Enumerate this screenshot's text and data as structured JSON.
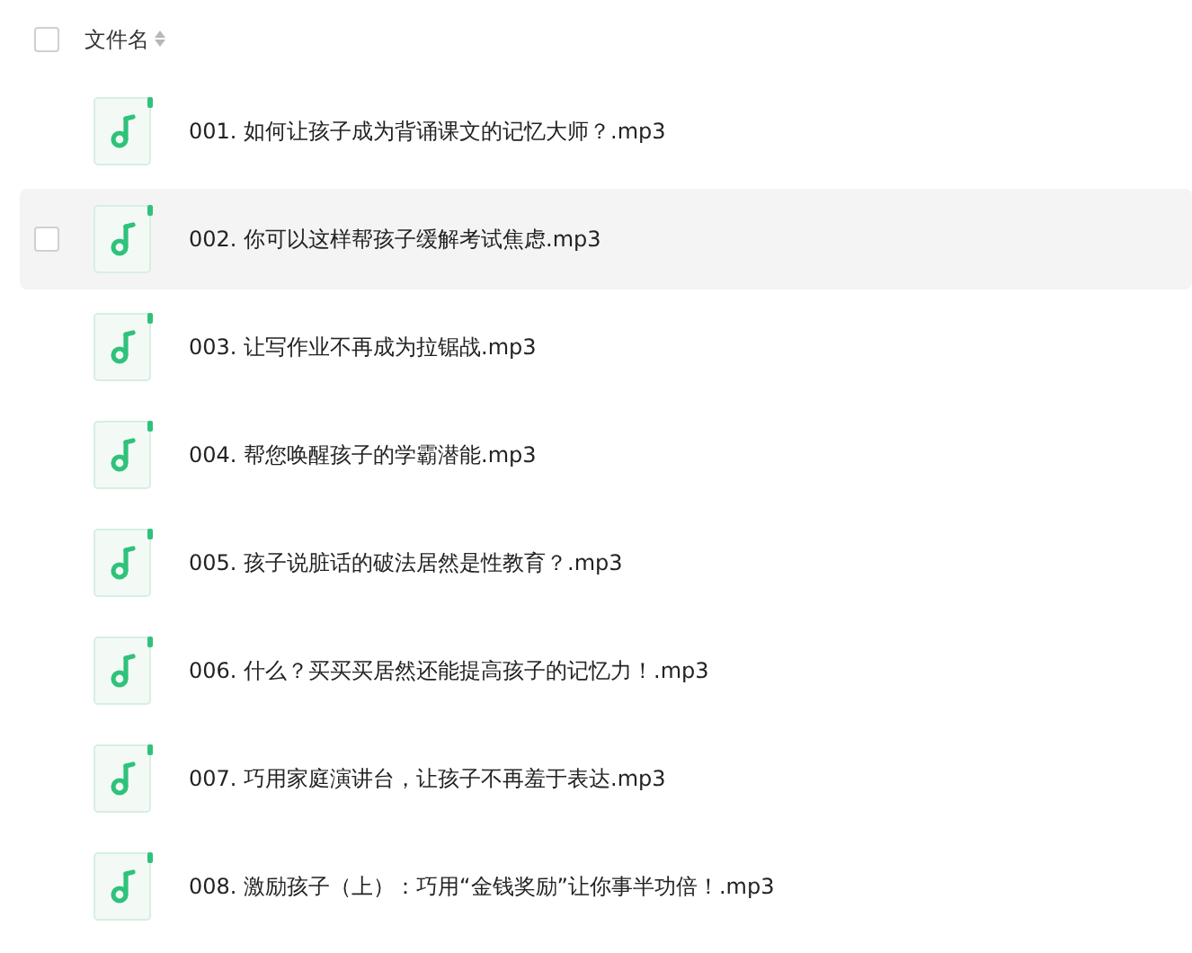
{
  "header": {
    "checked": false,
    "column": "文件名"
  },
  "files": [
    {
      "name": "001. 如何让孩子成为背诵课文的记忆大师？.mp3",
      "hovered": false
    },
    {
      "name": "002. 你可以这样帮孩子缓解考试焦虑.mp3",
      "hovered": true
    },
    {
      "name": "003. 让写作业不再成为拉锯战.mp3",
      "hovered": false
    },
    {
      "name": "004. 帮您唤醒孩子的学霸潜能.mp3",
      "hovered": false
    },
    {
      "name": "005. 孩子说脏话的破法居然是性教育？.mp3",
      "hovered": false
    },
    {
      "name": "006. 什么？买买买居然还能提高孩子的记忆力！.mp3",
      "hovered": false
    },
    {
      "name": "007. 巧用家庭演讲台，让孩子不再羞于表达.mp3",
      "hovered": false
    },
    {
      "name": "008. 激励孩子（上）：巧用“金钱奖励”让你事半功倍！.mp3",
      "hovered": false
    }
  ]
}
